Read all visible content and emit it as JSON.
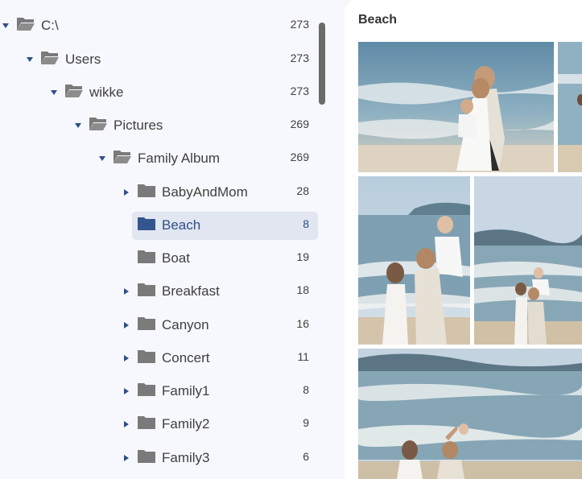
{
  "tree": {
    "items": [
      {
        "label": "C:\\",
        "count": "273",
        "expanded": true
      },
      {
        "label": "Users",
        "count": "273",
        "expanded": true
      },
      {
        "label": "wikke",
        "count": "273",
        "expanded": true
      },
      {
        "label": "Pictures",
        "count": "269",
        "expanded": true
      },
      {
        "label": "Family Album",
        "count": "269",
        "expanded": true
      },
      {
        "label": "BabyAndMom",
        "count": "28",
        "expanded": false
      },
      {
        "label": "Beach",
        "count": "8",
        "selected": true
      },
      {
        "label": "Boat",
        "count": "19"
      },
      {
        "label": "Breakfast",
        "count": "18",
        "expanded": false
      },
      {
        "label": "Canyon",
        "count": "16",
        "expanded": false
      },
      {
        "label": "Concert",
        "count": "11",
        "expanded": false
      },
      {
        "label": "Family1",
        "count": "8",
        "expanded": false
      },
      {
        "label": "Family2",
        "count": "9",
        "expanded": false
      },
      {
        "label": "Family3",
        "count": "6",
        "expanded": false
      }
    ]
  },
  "gallery": {
    "title": "Beach"
  },
  "colors": {
    "accent": "#2f4f87",
    "selected_bg": "#e1e6f0",
    "folder": "#7a7a7a",
    "folder_selected": "#34568f"
  },
  "icons": {
    "expanded": "chevron-down-icon",
    "collapsed": "chevron-right-icon",
    "folder_open": "folder-open-icon",
    "folder": "folder-icon"
  }
}
